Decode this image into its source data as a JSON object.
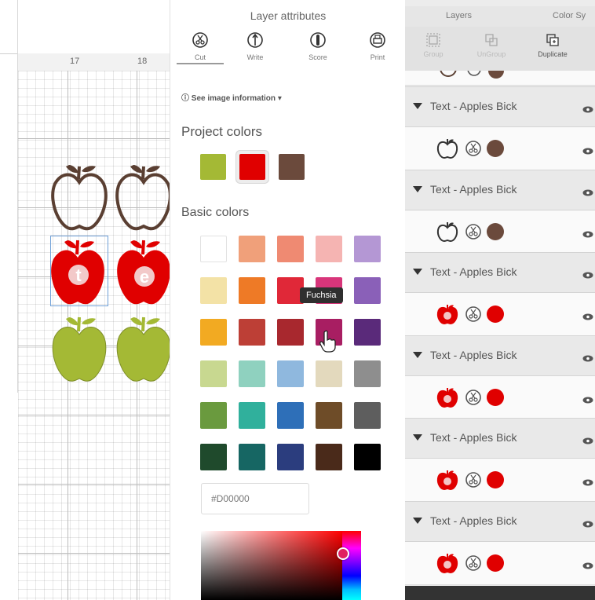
{
  "canvas": {
    "ruler": [
      "17",
      "18"
    ]
  },
  "attributes_panel": {
    "title": "Layer attributes",
    "operations": [
      {
        "label": "Cut",
        "icon": "scissors-icon",
        "active": true
      },
      {
        "label": "Write",
        "icon": "pen-icon",
        "active": false
      },
      {
        "label": "Score",
        "icon": "score-icon",
        "active": false
      },
      {
        "label": "Print",
        "icon": "printer-icon",
        "active": false
      }
    ],
    "see_info": "See image information",
    "project_colors_label": "Project colors",
    "project_colors": [
      "#a4b935",
      "#e00000",
      "#6b4a3c"
    ],
    "basic_colors_label": "Basic colors",
    "basic_colors": [
      [
        "#ffffff",
        "#f0a07a",
        "#ef8a72",
        "#f5b4b2",
        "#b497d4"
      ],
      [
        "#f3e2a6",
        "#ee7a26",
        "#e02838",
        "#d8357a",
        "#8a60b8"
      ],
      [
        "#f2aa22",
        "#bd3f36",
        "#a8282e",
        "#a81e62",
        "#5a2a7a"
      ],
      [
        "#c8d890",
        "#8fd1bf",
        "#8fb8de",
        "#e3d9bd",
        "#8e8e8e"
      ],
      [
        "#6a9a3e",
        "#30b09c",
        "#2e6fb8",
        "#6e4c28",
        "#5e5e5e"
      ],
      [
        "#1f4a2c",
        "#166663",
        "#2b3d7e",
        "#4a2a1a",
        "#000000"
      ]
    ],
    "tooltip": "Fuchsia",
    "hex_value": "#D00000"
  },
  "layers_panel": {
    "tabs": [
      "Layers",
      "Color Sy"
    ],
    "toolbar": [
      {
        "label": "Group",
        "icon": "group-icon",
        "disabled": true
      },
      {
        "label": "UnGroup",
        "icon": "ungroup-icon",
        "disabled": true
      },
      {
        "label": "Duplicate",
        "icon": "duplicate-icon",
        "disabled": false
      }
    ],
    "groups": [
      {
        "name": "Text - Apples Bick",
        "item_color": "#6b4a3c",
        "thumb": "outline"
      },
      {
        "name": "Text - Apples Bick",
        "item_color": "#6b4a3c",
        "thumb": "outline"
      },
      {
        "name": "Text - Apples Bick",
        "item_color": "#e00000",
        "thumb": "red"
      },
      {
        "name": "Text - Apples Bick",
        "item_color": "#e00000",
        "thumb": "red"
      },
      {
        "name": "Text - Apples Bick",
        "item_color": "#e00000",
        "thumb": "red"
      },
      {
        "name": "Text - Apples Bick",
        "item_color": "#e00000",
        "thumb": "red"
      }
    ]
  },
  "colors": {
    "apple_outline": "#5a3f32",
    "apple_red": "#e00000",
    "apple_green": "#a4b935"
  }
}
